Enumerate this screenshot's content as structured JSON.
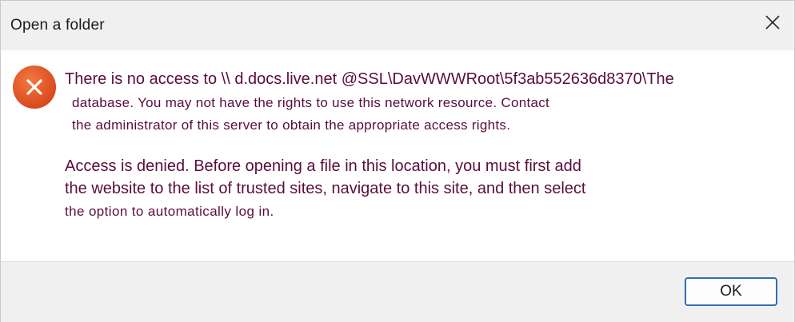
{
  "dialog": {
    "title": "Open a folder",
    "close_icon": "close-icon",
    "error_icon": "error-x-icon",
    "accent_color": "#e2531c",
    "text_color": "#5a0d3c",
    "message": {
      "line1": "There is no access to \\\\ d.docs.live.net @SSL\\DavWWWRoot\\5f3ab552636d8370\\The",
      "line2": "database. You may not have the rights to use this network resource. Contact",
      "line3": "the administrator of this server to obtain the appropriate access rights.",
      "line4": "Access is denied. Before opening a file in this location, you must first add",
      "line5": "the website to the list of trusted sites, navigate to this site, and then select",
      "line6": "the option to automatically log in."
    },
    "ok_label": "OK"
  }
}
